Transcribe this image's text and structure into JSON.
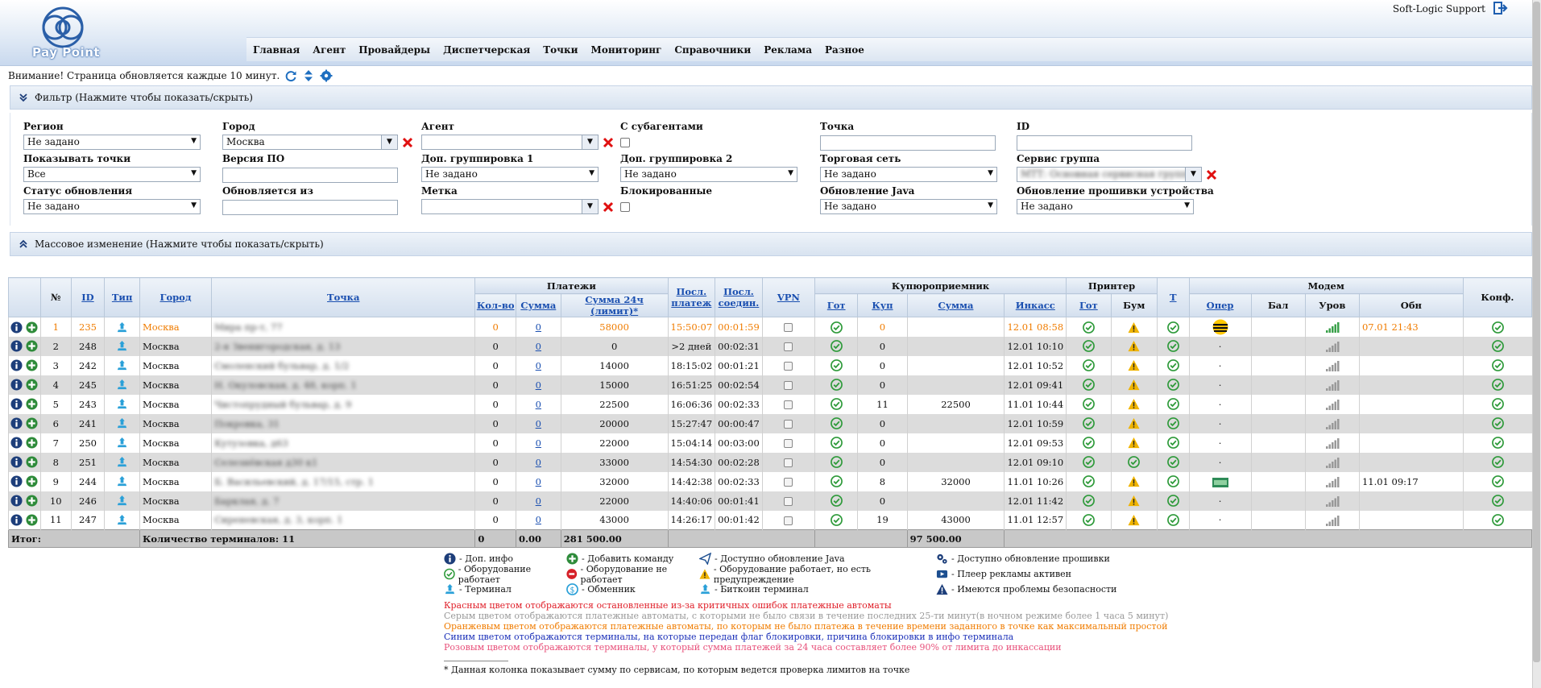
{
  "header": {
    "logo_text": "Pay Point",
    "support_user": "Soft-Logic Support",
    "nav": [
      "Главная",
      "Агент",
      "Провайдеры",
      "Диспетчерская",
      "Точки",
      "Мониторинг",
      "Справочники",
      "Реклама",
      "Разное"
    ]
  },
  "notice": "Внимание! Страница обновляется каждые 10 минут.",
  "filter": {
    "title": "Фильтр (Нажмите чтобы показать/скрыть)",
    "region_label": "Регион",
    "region_value": "Не задано",
    "city_label": "Город",
    "city_value": "Москва",
    "agent_label": "Агент",
    "agent_value": "",
    "subagents_label": "С субагентами",
    "point_label": "Точка",
    "id_label": "ID",
    "show_points_label": "Показывать точки",
    "show_points_value": "Все",
    "software_label": "Версия ПО",
    "group1_label": "Доп. группировка 1",
    "group1_value": "Не задано",
    "group2_label": "Доп. группировка 2",
    "group2_value": "Не задано",
    "retail_label": "Торговая сеть",
    "retail_value": "Не задано",
    "service_group_label": "Сервис группа",
    "service_group_value": "МТТ: Основная сервисная группа",
    "update_status_label": "Статус обновления",
    "update_status_value": "Не задано",
    "updated_from_label": "Обновляется из",
    "tag_label": "Метка",
    "tag_value": "",
    "blocked_label": "Блокированные",
    "java_update_label": "Обновление Java",
    "java_update_value": "Не задано",
    "firmware_label": "Обновление прошивки устройства",
    "firmware_value": "Не задано"
  },
  "mass_change": "Массовое изменение (Нажмите чтобы показать/скрыть)",
  "table": {
    "group_headers": {
      "payments": "Платежи",
      "last_payment": "Посл. платеж",
      "last_conn": "Посл. соедин.",
      "vpn": "VPN",
      "bill": "Купюроприемник",
      "printer": "Принтер",
      "t": "Т",
      "modem": "Модем",
      "conf": "Конф."
    },
    "headers": {
      "num": "№",
      "id": "ID",
      "type": "Тип",
      "city": "Город",
      "point": "Точка",
      "cnt": "Кол-во",
      "sum": "Сумма",
      "sum24": "Сумма 24ч (лимит)*",
      "b_ready": "Гот",
      "b_kup": "Куп",
      "b_sum": "Сумма",
      "b_inkas": "Инкасс",
      "p_ready": "Гот",
      "p_paper": "Бум",
      "m_oper": "Опер",
      "m_bal": "Бал",
      "m_level": "Уров",
      "m_upd": "Обн"
    },
    "rows": [
      {
        "num": "1",
        "id": "235",
        "city": "Москва",
        "point": "Мира пр-т, 77",
        "cnt": "0",
        "sum": "0",
        "sum24": "58000",
        "last_pay": "15:50:07",
        "last_conn": "00:01:59",
        "kup": "0",
        "bsum": "",
        "inkas": "12.01 08:58",
        "paper": "warn",
        "oper": "beeline",
        "mupd": "07.01 21:43",
        "style": "orange"
      },
      {
        "num": "2",
        "id": "248",
        "city": "Москва",
        "point": "2-я Звенигородская, д. 13",
        "cnt": "0",
        "sum": "0",
        "sum24": "0",
        "last_pay": ">2 дней",
        "last_conn": "00:02:31",
        "kup": "0",
        "bsum": "",
        "inkas": "12.01 10:10",
        "paper": "warn",
        "oper": "·",
        "mupd": "",
        "style": "even"
      },
      {
        "num": "3",
        "id": "242",
        "city": "Москва",
        "point": "Смоленский бульвар, д. 1/2",
        "cnt": "0",
        "sum": "0",
        "sum24": "14000",
        "last_pay": "18:15:02",
        "last_conn": "00:01:21",
        "kup": "0",
        "bsum": "",
        "inkas": "12.01 10:52",
        "paper": "warn",
        "oper": "·",
        "mupd": "",
        "style": "odd"
      },
      {
        "num": "4",
        "id": "245",
        "city": "Москва",
        "point": "Н. Окуловская, д. 48, корп. 1",
        "cnt": "0",
        "sum": "0",
        "sum24": "15000",
        "last_pay": "16:51:25",
        "last_conn": "00:02:54",
        "kup": "0",
        "bsum": "",
        "inkas": "12.01 09:41",
        "paper": "warn",
        "oper": "·",
        "mupd": "",
        "style": "even"
      },
      {
        "num": "5",
        "id": "243",
        "city": "Москва",
        "point": "Чистопрудный бульвар, д. 9",
        "cnt": "0",
        "sum": "0",
        "sum24": "22500",
        "last_pay": "16:06:36",
        "last_conn": "00:02:33",
        "kup": "11",
        "bsum": "22500",
        "inkas": "11.01 10:44",
        "paper": "warn",
        "oper": "·",
        "mupd": "",
        "style": "odd"
      },
      {
        "num": "6",
        "id": "241",
        "city": "Москва",
        "point": "Покровка, 31",
        "cnt": "0",
        "sum": "0",
        "sum24": "20000",
        "last_pay": "15:27:47",
        "last_conn": "00:00:47",
        "kup": "0",
        "bsum": "",
        "inkas": "12.01 10:59",
        "paper": "warn",
        "oper": "·",
        "mupd": "",
        "style": "even"
      },
      {
        "num": "7",
        "id": "250",
        "city": "Москва",
        "point": "Кутузовка, д63",
        "cnt": "0",
        "sum": "0",
        "sum24": "22000",
        "last_pay": "15:04:14",
        "last_conn": "00:03:00",
        "kup": "0",
        "bsum": "",
        "inkas": "12.01 09:53",
        "paper": "warn",
        "oper": "·",
        "mupd": "",
        "style": "odd"
      },
      {
        "num": "8",
        "id": "251",
        "city": "Москва",
        "point": "Селезнёвская д30 к1",
        "cnt": "0",
        "sum": "0",
        "sum24": "33000",
        "last_pay": "14:54:30",
        "last_conn": "00:02:28",
        "kup": "0",
        "bsum": "",
        "inkas": "12.01 09:10",
        "paper": "ok",
        "oper": "·",
        "mupd": "",
        "style": "even"
      },
      {
        "num": "9",
        "id": "244",
        "city": "Москва",
        "point": "Б. Васильевский, д. 17/15, стр. 1",
        "cnt": "0",
        "sum": "0",
        "sum24": "32000",
        "last_pay": "14:42:38",
        "last_conn": "00:02:33",
        "kup": "8",
        "bsum": "32000",
        "inkas": "11.01 10:26",
        "paper": "warn",
        "oper": "megafon",
        "mupd": "11.01 09:17",
        "style": "odd"
      },
      {
        "num": "10",
        "id": "246",
        "city": "Москва",
        "point": "Барклая, д. 7",
        "cnt": "0",
        "sum": "0",
        "sum24": "22000",
        "last_pay": "14:40:06",
        "last_conn": "00:01:41",
        "kup": "0",
        "bsum": "",
        "inkas": "12.01 11:42",
        "paper": "warn",
        "oper": "·",
        "mupd": "",
        "style": "even"
      },
      {
        "num": "11",
        "id": "247",
        "city": "Москва",
        "point": "Сиреневская, д. 3, корп. 1",
        "cnt": "0",
        "sum": "0",
        "sum24": "43000",
        "last_pay": "14:26:17",
        "last_conn": "00:01:42",
        "kup": "19",
        "bsum": "43000",
        "inkas": "11.01 12:57",
        "paper": "warn",
        "oper": "·",
        "mupd": "",
        "style": "odd"
      }
    ],
    "total": {
      "label": "Итог:",
      "count_label": "Количество терминалов: 11",
      "cnt": "0",
      "sum": "0.00",
      "sum24": "281 500.00",
      "bsum": "97 500.00"
    }
  },
  "legend": {
    "row1": [
      "- Доп. инфо",
      "- Добавить команду",
      "- Доступно обновление Java",
      "- Доступно обновление прошивки"
    ],
    "row2": [
      "- Оборудование работает",
      "- Оборудование не работает",
      "- Оборудование работает, но есть предупреждение",
      "- Плеер рекламы активен"
    ],
    "row3": [
      "- Терминал",
      "- Обменник",
      "- Биткоин терминал",
      "- Имеются проблемы безопасности"
    ],
    "notes": [
      {
        "text": "Красным цветом отображаются остановленные из-за критичных ошибок платежные автоматы",
        "color": "#e0202a"
      },
      {
        "text": "Серым цветом отображаются платежные автоматы, с которыми не было связи в течение последних 25-ти минут(в ночном режиме более 1 часа 5 минут)",
        "color": "#999999"
      },
      {
        "text": "Оранжевым цветом отображаются платежные автоматы, по которым не было платежа в течение времени заданного в точке как максимальный простой",
        "color": "#f07c00"
      },
      {
        "text": "Синим цветом отображаются терминалы, на которые передан флаг блокировки, причина блокировки в инфо терминала",
        "color": "#1a2fb8"
      },
      {
        "text": "Розовым цветом отображаются терминалы, у который сумма платежей за 24 часа составляет более 90% от лимита до инкассации",
        "color": "#e8507a"
      }
    ],
    "footnote": "* Данная колонка показывает сумму по сервисам, по которым ведется проверка лимитов на точке"
  },
  "colors": {
    "accent": "#1a4fb0",
    "ok": "#2e9a3a",
    "warn": "#f0b400",
    "error": "#e0202a",
    "orange": "#f07c00"
  }
}
